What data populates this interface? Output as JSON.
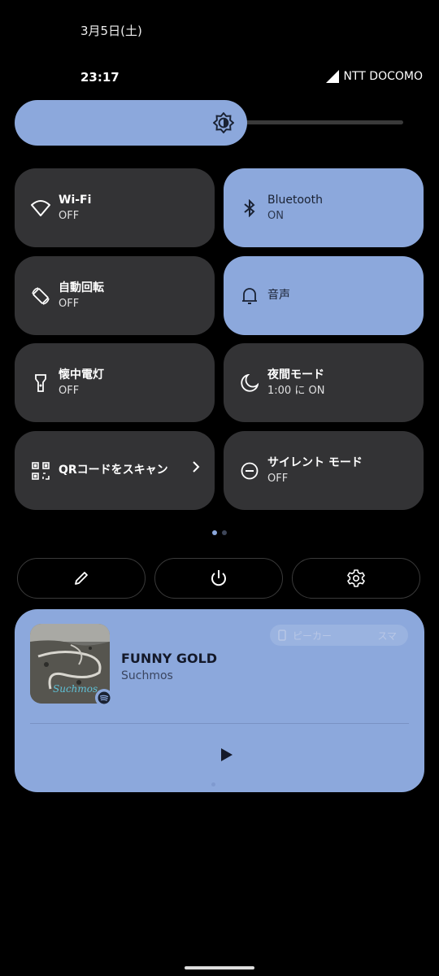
{
  "status": {
    "date": "3月5日(土)",
    "time": "23:17",
    "carrier": "NTT DOCOMO"
  },
  "brightness": {
    "level": 0.59,
    "icon": "brightness-icon"
  },
  "tiles": [
    {
      "title": "Wi-Fi",
      "sub": "OFF",
      "state": "off",
      "icon": "wifi-icon"
    },
    {
      "title": "Bluetooth",
      "sub": "ON",
      "state": "on",
      "icon": "bluetooth-icon"
    },
    {
      "title": "自動回転",
      "sub": "OFF",
      "state": "off",
      "icon": "rotate-icon"
    },
    {
      "title": "音声",
      "sub": "",
      "state": "on",
      "icon": "bell-icon"
    },
    {
      "title": "懐中電灯",
      "sub": "OFF",
      "state": "off",
      "icon": "flashlight-icon"
    },
    {
      "title": "夜間モード",
      "sub": "1:00 に ON",
      "state": "off",
      "icon": "moon-icon"
    },
    {
      "title": "QRコードをスキャン",
      "sub": "",
      "state": "off",
      "icon": "qr-icon"
    },
    {
      "title": "サイレント モード",
      "sub": "OFF",
      "state": "off",
      "icon": "dnd-icon"
    }
  ],
  "page_indicator": {
    "pages": 2,
    "current": 1
  },
  "actions": [
    "edit-icon",
    "power-icon",
    "settings-icon"
  ],
  "media": {
    "title": "FUNNY GOLD",
    "artist": "Suchmos",
    "output": "ピーカー",
    "output_more": "スマ",
    "art_text": "Suchmos",
    "colors": {
      "card": "#8ca8dc",
      "title": "#14192a"
    }
  }
}
